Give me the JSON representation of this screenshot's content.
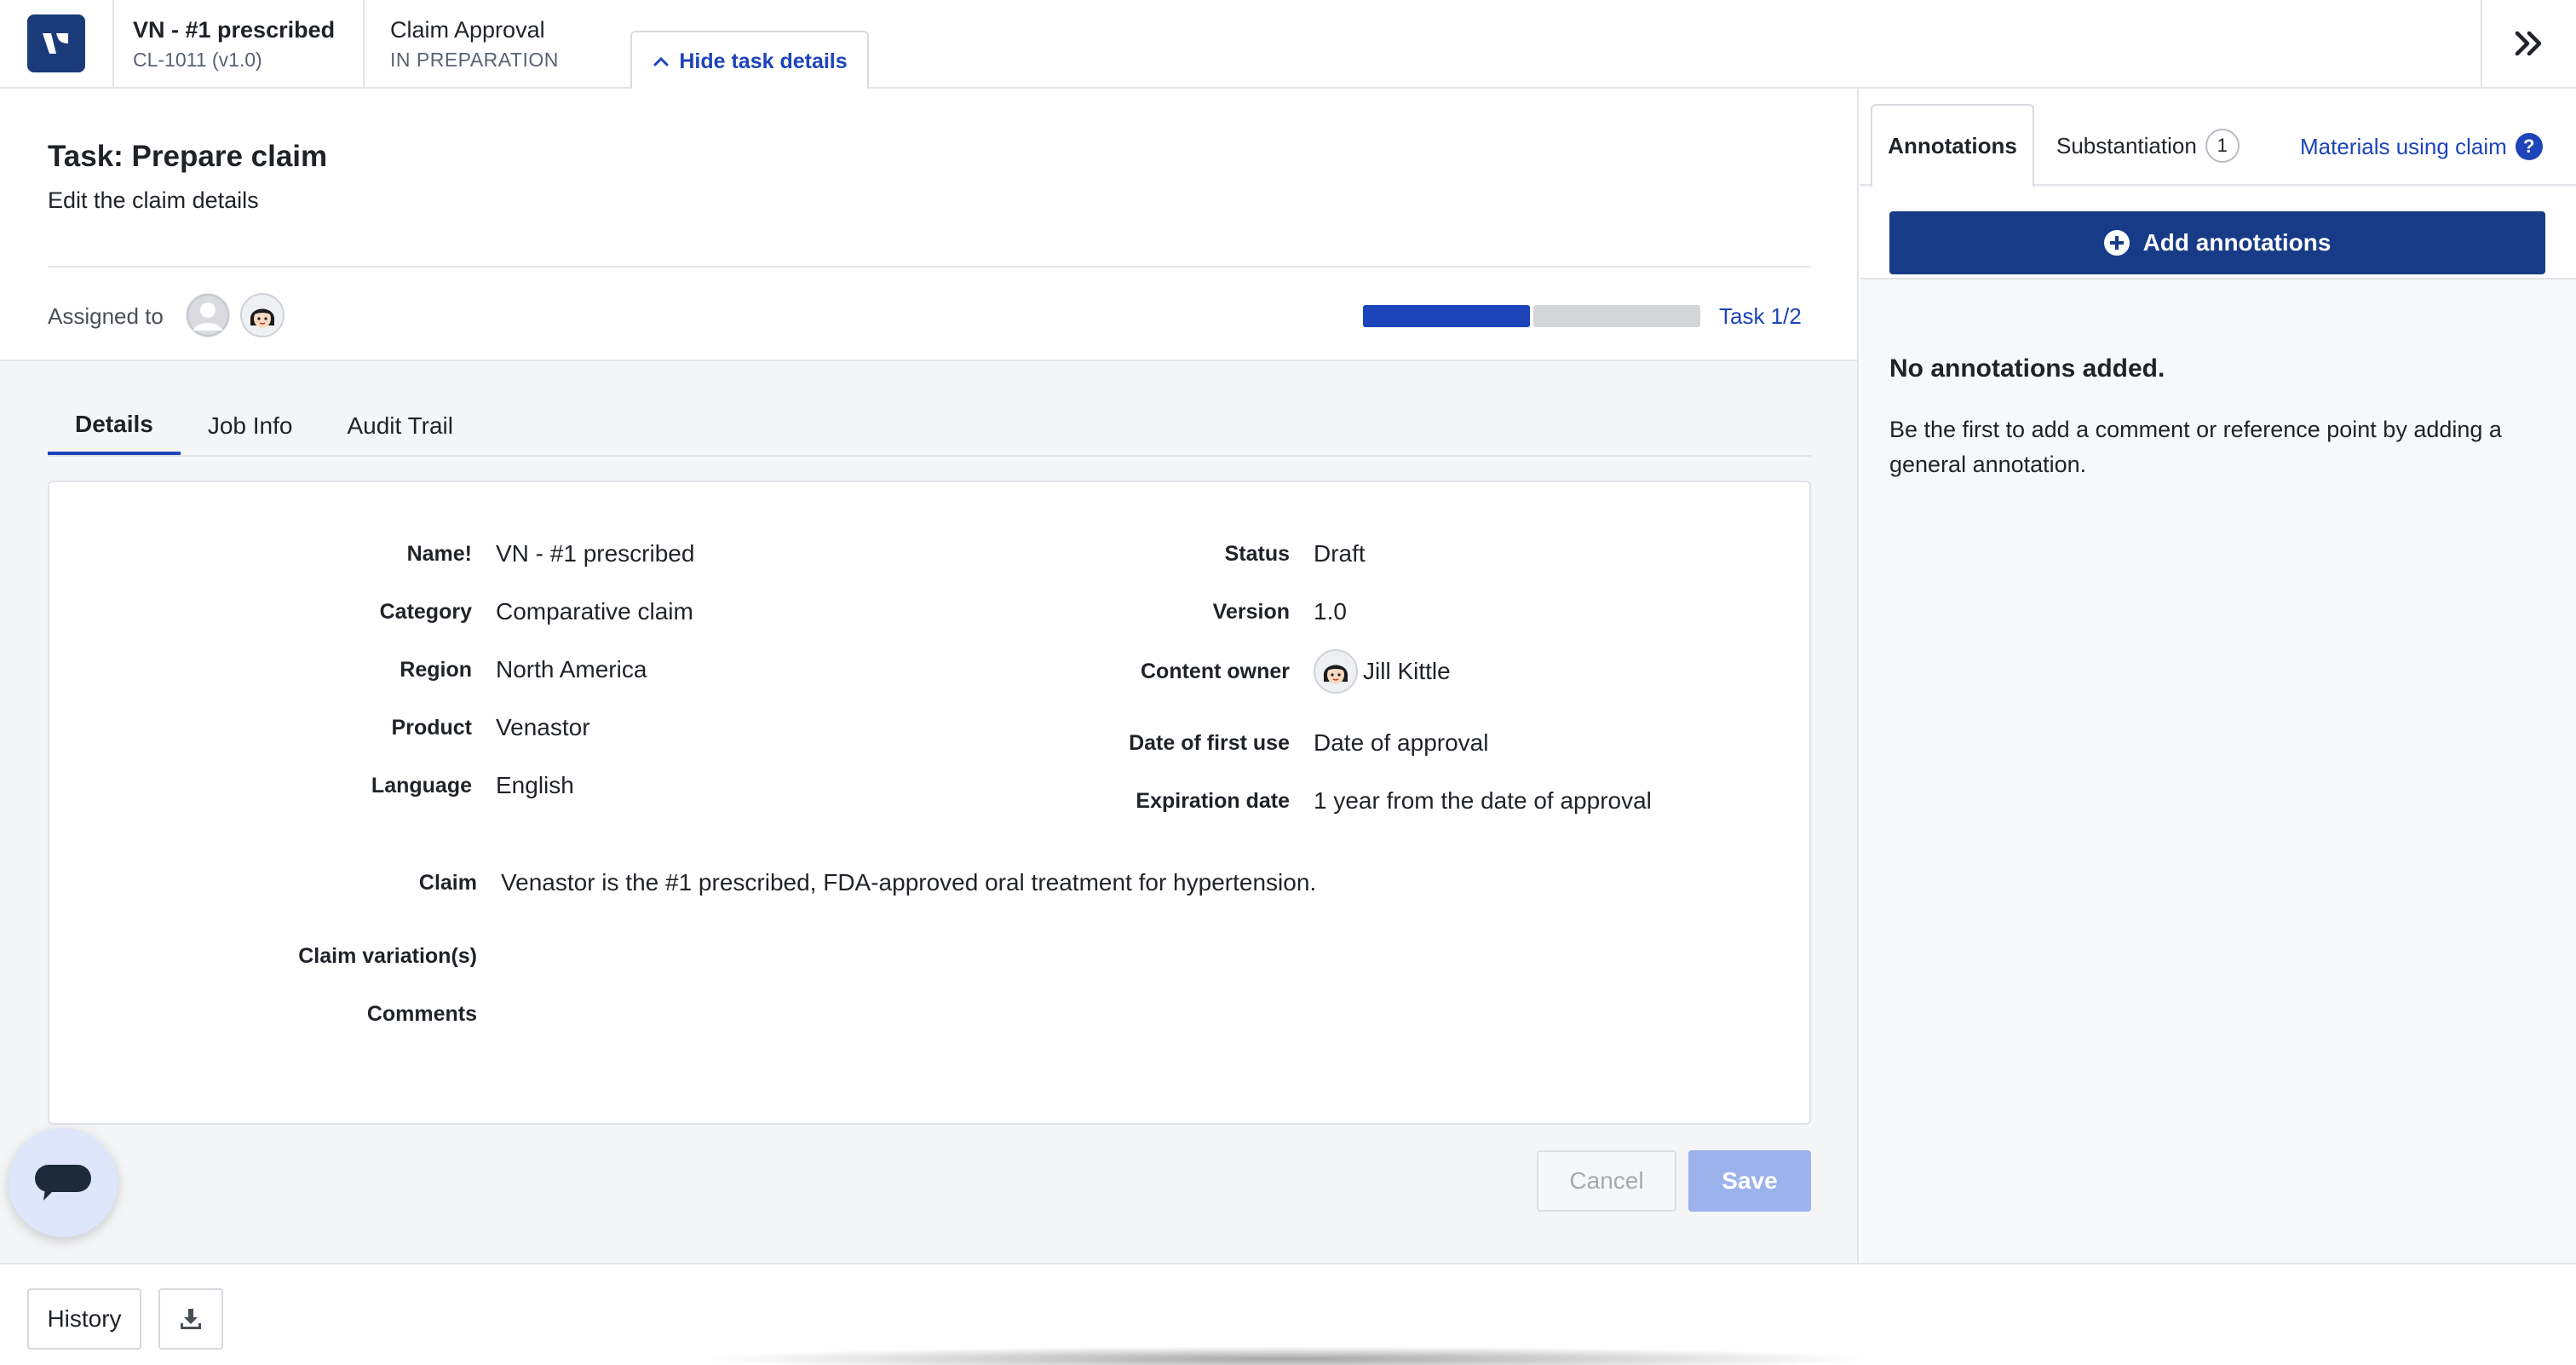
{
  "header": {
    "claim_title": "VN - #1 prescribed",
    "claim_id": "CL-1011 (v1.0)",
    "workflow_title": "Claim Approval",
    "workflow_status": "IN PREPARATION",
    "hide_details_label": "Hide task details"
  },
  "task": {
    "title": "Task: Prepare claim",
    "description": "Edit the claim details",
    "assigned_label": "Assigned to",
    "progress": {
      "completed": 1,
      "total": 2
    },
    "counter": "Task 1/2"
  },
  "tabs": [
    "Details",
    "Job Info",
    "Audit Trail"
  ],
  "details": {
    "left": [
      {
        "label": "Name!",
        "value": "VN - #1 prescribed"
      },
      {
        "label": "Category",
        "value": "Comparative claim"
      },
      {
        "label": "Region",
        "value": "North America"
      },
      {
        "label": "Product",
        "value": "Venastor"
      },
      {
        "label": "Language",
        "value": "English"
      }
    ],
    "right": [
      {
        "label": "Status",
        "value": "Draft"
      },
      {
        "label": "Version",
        "value": "1.0"
      },
      {
        "label": "Content owner",
        "value": "Jill Kittle"
      },
      {
        "label": "Date of first use",
        "value": "Date of approval"
      },
      {
        "label": "Expiration date",
        "value": "1 year from the date of approval"
      }
    ],
    "claim": {
      "label": "Claim",
      "value": "Venastor is the #1 prescribed, FDA-approved oral treatment for hypertension."
    },
    "variations_label": "Claim variation(s)",
    "comments_label": "Comments"
  },
  "actions": {
    "cancel": "Cancel",
    "save": "Save"
  },
  "side": {
    "tab_annotations": "Annotations",
    "tab_substantiation": "Substantiation",
    "substantiation_count": "1",
    "materials_link": "Materials using claim",
    "add_button": "Add annotations",
    "empty_title": "No annotations added.",
    "empty_text": "Be the first to add a comment or reference point by adding a general annotation."
  },
  "footer": {
    "history": "History"
  },
  "colors": {
    "primary": "#1d44b8",
    "primary_dark": "#173b87",
    "logo": "#1b3a7a",
    "save_disabled": "#9bb2ec"
  }
}
